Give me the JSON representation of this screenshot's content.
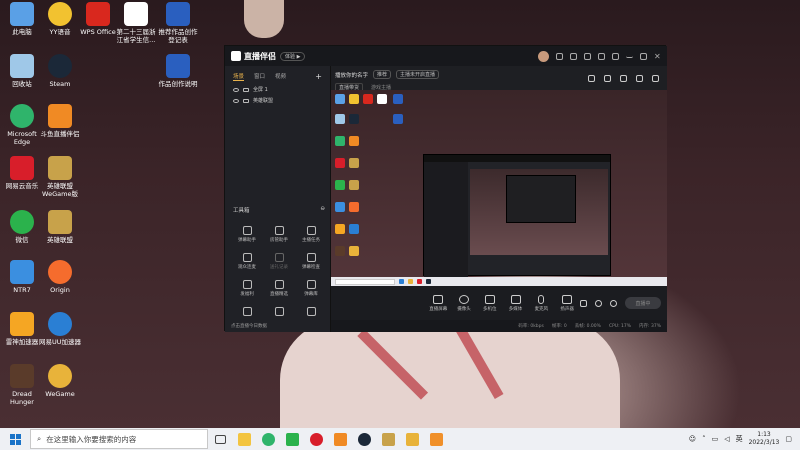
{
  "desktop": {
    "icons": [
      {
        "label": "此电脑",
        "name": "this-pc-icon",
        "color": "#5aa0e6"
      },
      {
        "label": "YY语音",
        "name": "yy-voice-icon",
        "color": "#f2c230"
      },
      {
        "label": "WPS Office",
        "name": "wps-office-icon",
        "color": "#d9281e"
      },
      {
        "label": "第二十三届浙江省学生信...",
        "name": "document-icon",
        "color": "#ffffff"
      },
      {
        "label": "推荐作品创作登记表",
        "name": "word-document-icon",
        "color": "#2a5fbf"
      },
      {
        "label": "回收站",
        "name": "recycle-bin-icon",
        "color": "#9fc8e8"
      },
      {
        "label": "Steam",
        "name": "steam-icon",
        "color": "#1b2838"
      },
      {
        "label": "作品创作说明",
        "name": "word-document-icon",
        "color": "#2a5fbf"
      },
      {
        "label": "Microsoft Edge",
        "name": "edge-icon",
        "color": "#2fb46b"
      },
      {
        "label": "斗鱼直播伴侣",
        "name": "douyu-icon",
        "color": "#f08a24"
      },
      {
        "label": "网易云音乐",
        "name": "netease-music-icon",
        "color": "#d81e2a"
      },
      {
        "label": "英雄联盟WeGame版",
        "name": "league-of-legends-icon",
        "color": "#c8a24a"
      },
      {
        "label": "微信",
        "name": "wechat-icon",
        "color": "#2bb24c"
      },
      {
        "label": "英雄联盟",
        "name": "league-of-legends-icon",
        "color": "#c8a24a"
      },
      {
        "label": "NTR7",
        "name": "ntr-icon",
        "color": "#3b8fe0"
      },
      {
        "label": "Origin",
        "name": "origin-icon",
        "color": "#f56c2d"
      },
      {
        "label": "雷神加速器",
        "name": "leishen-accelerator-icon",
        "color": "#f5a623"
      },
      {
        "label": "网易UU加速器",
        "name": "uu-accelerator-icon",
        "color": "#2a7fd4"
      },
      {
        "label": "Dread Hunger",
        "name": "dread-hunger-icon",
        "color": "#5a3b2a"
      },
      {
        "label": "WeGame",
        "name": "wegame-icon",
        "color": "#e8b33a"
      }
    ]
  },
  "app": {
    "title": "直播伴侣",
    "title_pill": "体验 ▶",
    "tabs": [
      "场景",
      "窗口",
      "视频"
    ],
    "scene_items": [
      "全屏 1",
      "英雄联盟"
    ],
    "tools_label": "工具箱",
    "tools": [
      "弹幕助手",
      "房管助手",
      "主播任务",
      "观众连麦",
      "送礼记录",
      "弹幕检查",
      "发福利",
      "直播精选",
      "弹幕库",
      "",
      "",
      ""
    ],
    "side_status": "点击直播今日数据",
    "header_title": "播放你的名字",
    "header_tag": "推荐",
    "header_info": "主播未开启直播",
    "sub_items": [
      "直播带货",
      "游戏主播"
    ],
    "controls": [
      "直播屏幕",
      "摄像头",
      "多机位",
      "多媒体",
      "麦克风",
      "扬声器"
    ],
    "go_live": "直播中",
    "status_items": [
      "码率: 0kbps",
      "帧率: 0",
      "丢帧: 0.00%",
      "CPU: 17%",
      "内存: 37%"
    ]
  },
  "taskbar": {
    "search_placeholder": "在这里输入你要搜索的内容",
    "time": "1:13",
    "date": "2022/3/13"
  }
}
